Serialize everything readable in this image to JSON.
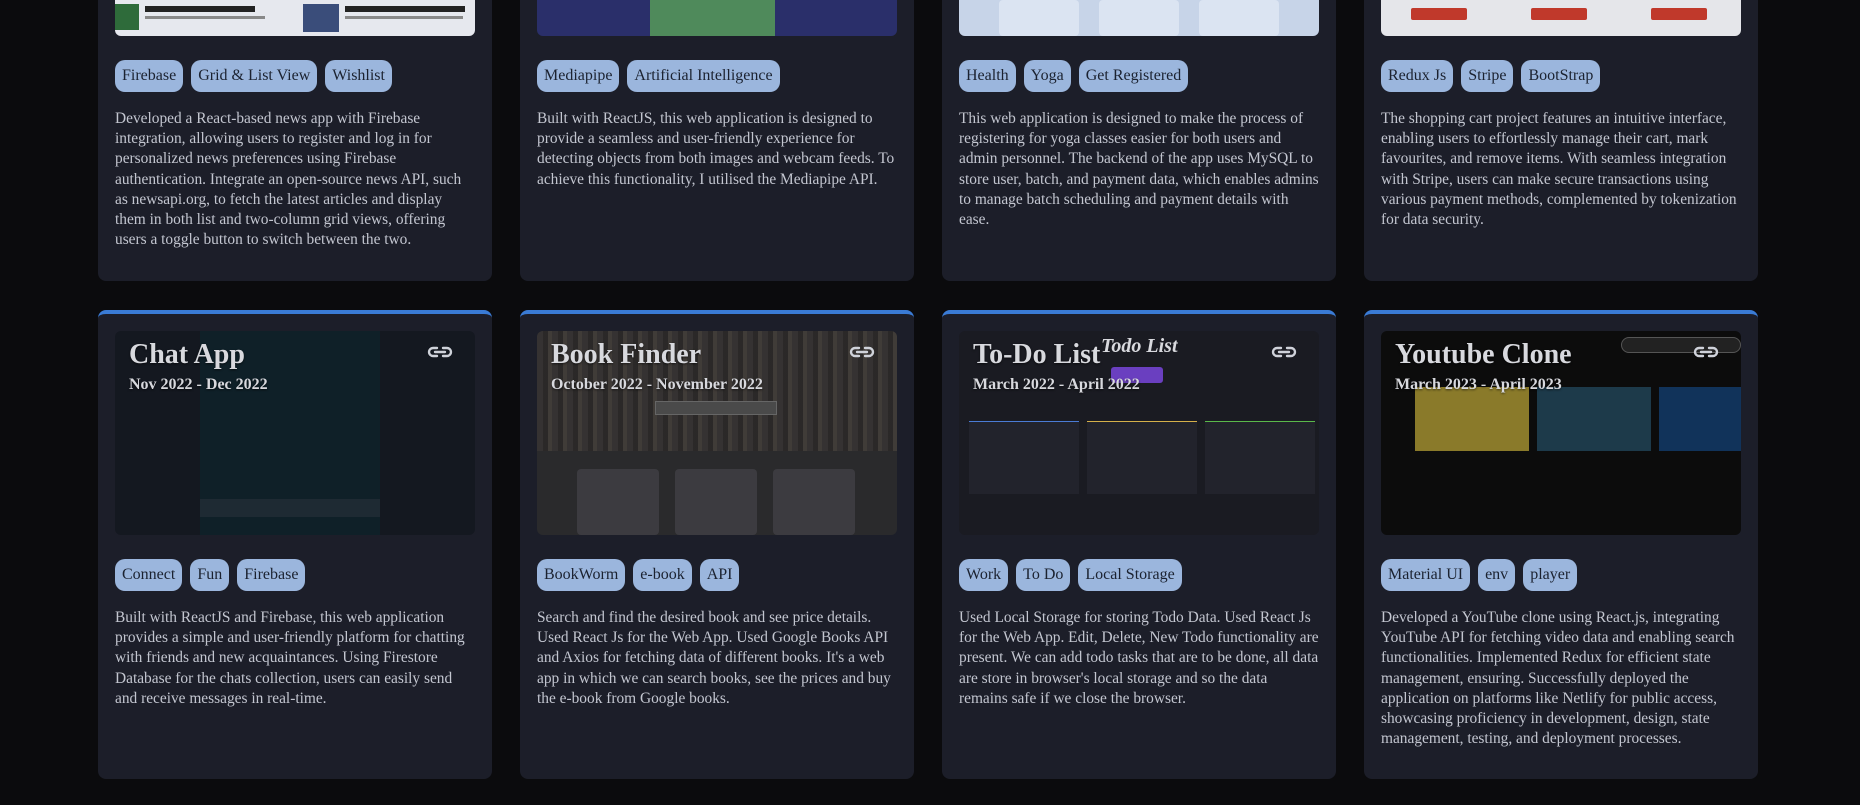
{
  "top_cards": [
    {
      "tags": [
        "Firebase",
        "Grid & List View",
        "Wishlist"
      ],
      "description": "Developed a React-based news app with Firebase integration, allowing users to register and log in for personalized news preferences using Firebase authentication. Integrate an open-source news API, such as newsapi.org, to fetch the latest articles and display them in both list and two-column grid views, offering users a toggle button to switch between the two."
    },
    {
      "tags": [
        "Mediapipe",
        "Artificial Intelligence"
      ],
      "description": "Built with ReactJS, this web application is designed to provide a seamless and user-friendly experience for detecting objects from both images and webcam feeds. To achieve this functionality, I utilised the Mediapipe API."
    },
    {
      "tags": [
        "Health",
        "Yoga",
        "Get Registered"
      ],
      "description": "This web application is designed to make the process of registering for yoga classes easier for both users and admin personnel. The backend of the app uses MySQL to store user, batch, and payment data, which enables admins to manage batch scheduling and payment details with ease."
    },
    {
      "tags": [
        "Redux Js",
        "Stripe",
        "BootStrap"
      ],
      "description": "The shopping cart project features an intuitive interface, enabling users to effortlessly manage their cart, mark favourites, and remove items. With seamless integration with Stripe, users can make secure transactions using various payment methods, complemented by tokenization for data security."
    }
  ],
  "bottom_cards": [
    {
      "title": "Chat App",
      "date": "Nov 2022 - Dec 2022",
      "tags": [
        "Connect",
        "Fun",
        "Firebase"
      ],
      "description": "Built with ReactJS and Firebase, this web application provides a simple and user-friendly platform for chatting with friends and new acquaintances. Using Firestore Database for the chats collection, users can easily send and receive messages in real-time."
    },
    {
      "title": "Book Finder",
      "date": "October 2022 - November 2022",
      "tags": [
        "BookWorm",
        "e-book",
        "API"
      ],
      "description": "Search and find the desired book and see price details. Used React Js for the Web App. Used Google Books API and Axios for fetching data of different books. It's a web app in which we can search books, see the prices and buy the e-book from Google books."
    },
    {
      "title": "To-Do List",
      "date": "March 2022 - April 2022",
      "thumb_heading": "Todo List",
      "tags": [
        "Work",
        "To Do",
        "Local Storage"
      ],
      "description": "Used Local Storage for storing Todo Data. Used React Js for the Web App. Edit, Delete, New Todo functionality are present. We can add todo tasks that are to be done, all data are store in browser's local storage and so the data remains safe if we close the browser."
    },
    {
      "title": "Youtube Clone",
      "date": "March 2023 - April 2023",
      "tags": [
        "Material UI",
        "env",
        "player"
      ],
      "description": "Developed a YouTube clone using React.js, integrating YouTube API for fetching video data and enabling search functionalities. Implemented Redux for efficient state management, ensuring. Successfully deployed the application on platforms like Netlify for public access, showcasing proficiency in development, design, state management, testing, and deployment processes."
    }
  ],
  "colors": {
    "page_bg": "#0b0b0d",
    "card_bg": "#1c1e29",
    "tag_bg": "#9bb6dd",
    "accent": "#3a7bd5"
  },
  "icons": {
    "project_link": "link-icon"
  }
}
